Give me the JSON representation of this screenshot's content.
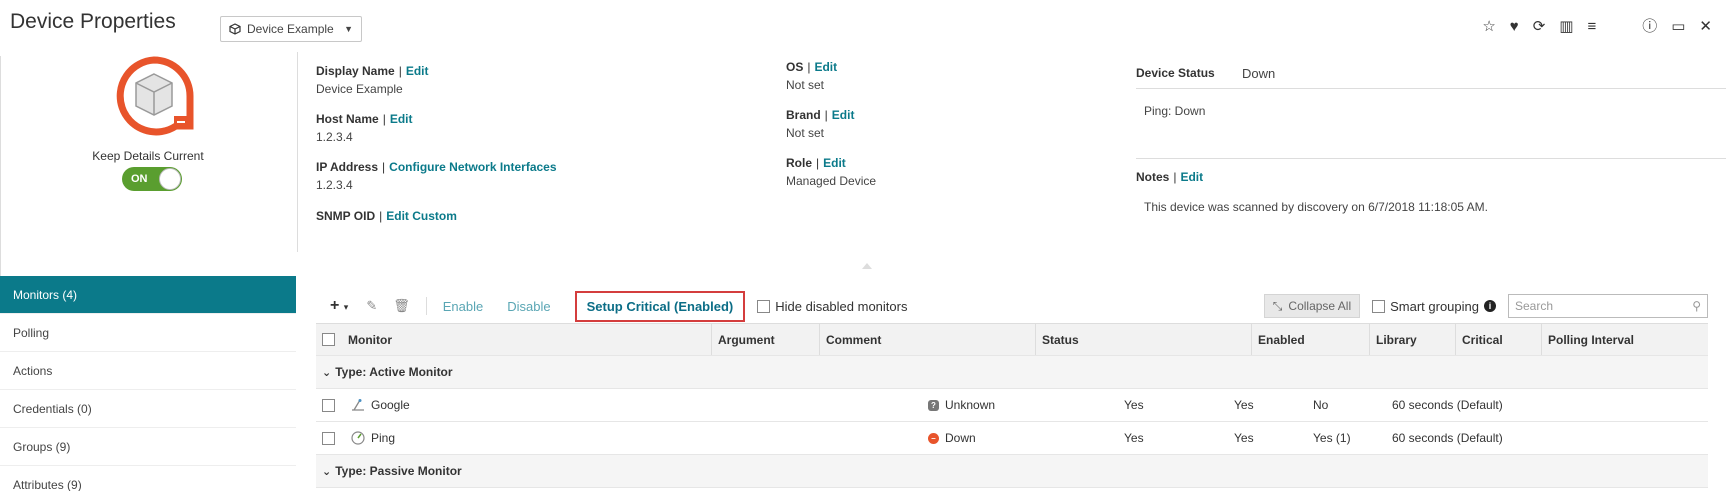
{
  "header": {
    "title": "Device Properties",
    "device_select": "Device Example",
    "icons": [
      "star-icon",
      "heart-pulse-icon",
      "refresh-icon",
      "library-icon",
      "menu-list-icon",
      "help-icon",
      "maximize-icon",
      "close-icon"
    ]
  },
  "device_card": {
    "keep_details_label": "Keep Details Current",
    "toggle_label": "ON"
  },
  "properties": {
    "display_name": {
      "label": "Display Name",
      "sep": "|",
      "link": "Edit",
      "value": "Device Example"
    },
    "host_name": {
      "label": "Host Name",
      "sep": "|",
      "link": "Edit",
      "value": "1.2.3.4"
    },
    "ip_address": {
      "label": "IP Address",
      "sep": "|",
      "link": "Configure Network Interfaces",
      "value": "1.2.3.4"
    },
    "snmp_oid": {
      "label": "SNMP OID",
      "sep": "|",
      "link": "Edit Custom"
    },
    "os": {
      "label": "OS",
      "sep": "|",
      "link": "Edit",
      "value": "Not set"
    },
    "brand": {
      "label": "Brand",
      "sep": "|",
      "link": "Edit",
      "value": "Not set"
    },
    "role": {
      "label": "Role",
      "sep": "|",
      "link": "Edit",
      "value": "Managed Device"
    }
  },
  "status_panel": {
    "label": "Device Status",
    "value": "Down",
    "ping": "Ping: Down",
    "notes_label": "Notes",
    "notes_sep": "|",
    "notes_link": "Edit",
    "notes_text": "This device was scanned by discovery on 6/7/2018 11:18:05 AM."
  },
  "sidebar": {
    "items": [
      {
        "label": "Monitors (4)",
        "active": true
      },
      {
        "label": "Polling"
      },
      {
        "label": "Actions"
      },
      {
        "label": "Credentials (0)"
      },
      {
        "label": "Groups (9)"
      },
      {
        "label": "Attributes (9)"
      }
    ]
  },
  "toolbar": {
    "add": "+",
    "add_caret": "▾",
    "enable": "Enable",
    "disable": "Disable",
    "setup_critical": "Setup Critical (Enabled)",
    "hide_disabled": "Hide disabled monitors",
    "collapse_all": "Collapse All",
    "smart_grouping": "Smart grouping",
    "search_placeholder": "Search"
  },
  "table": {
    "columns": [
      "Monitor",
      "Argument",
      "Comment",
      "Status",
      "Enabled",
      "Library",
      "Critical",
      "Polling Interval"
    ],
    "groups": [
      {
        "label": "Type: Active Monitor",
        "rows": [
          {
            "monitor": "Google",
            "icon": "http-icon",
            "status": "Unknown",
            "status_kind": "unknown",
            "enabled": "Yes",
            "library": "Yes",
            "critical": "No",
            "interval": "60 seconds (Default)"
          },
          {
            "monitor": "Ping",
            "icon": "ping-icon",
            "status": "Down",
            "status_kind": "down",
            "enabled": "Yes",
            "library": "Yes",
            "critical": "Yes (1)",
            "interval": "60 seconds (Default)"
          }
        ]
      },
      {
        "label": "Type: Passive Monitor",
        "rows": []
      }
    ]
  },
  "colors": {
    "accent": "#0b7a8a",
    "link": "#0b7a8a",
    "highlight_border": "#d43d3d",
    "toggle_on": "#5a9e2f",
    "status_down": "#e8542b"
  }
}
